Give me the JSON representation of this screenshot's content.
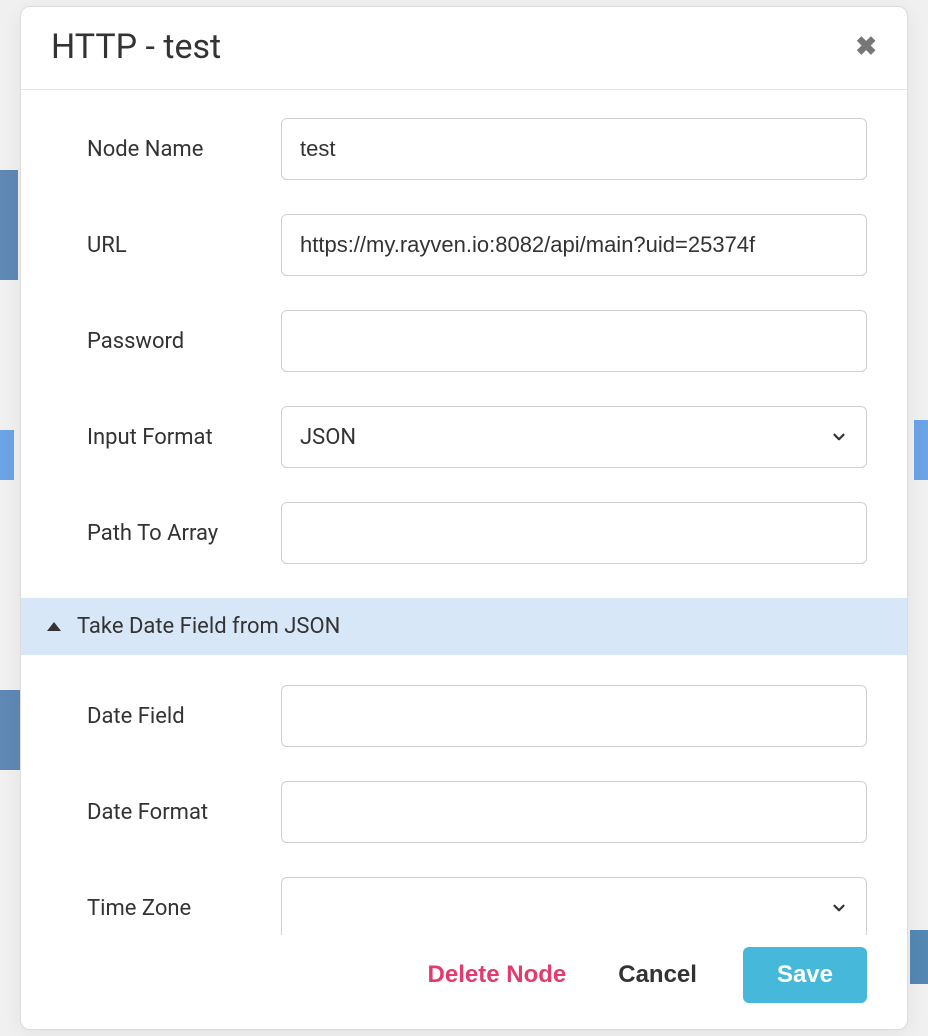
{
  "modal": {
    "title": "HTTP - test",
    "close_icon": "close-icon"
  },
  "labels": {
    "node_name": "Node Name",
    "url": "URL",
    "password": "Password",
    "input_format": "Input Format",
    "path_to_array": "Path To Array",
    "date_field": "Date Field",
    "date_format": "Date Format",
    "time_zone": "Time Zone"
  },
  "values": {
    "node_name": "test",
    "url": "https://my.rayven.io:8082/api/main?uid=25374f",
    "password": "",
    "input_format": "JSON",
    "path_to_array": "",
    "date_field": "",
    "date_format": "",
    "time_zone": ""
  },
  "accordion": {
    "take_date_field": "Take Date Field from JSON"
  },
  "footer": {
    "delete": "Delete Node",
    "cancel": "Cancel",
    "save": "Save"
  }
}
